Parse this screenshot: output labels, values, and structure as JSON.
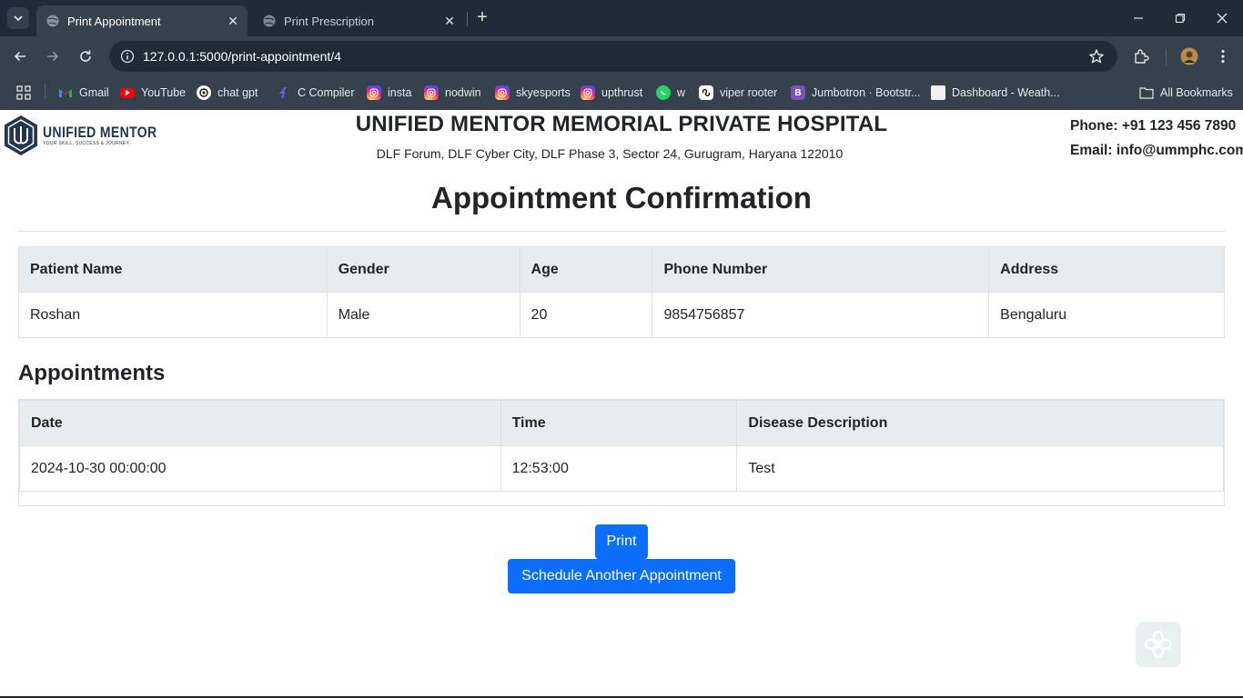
{
  "browser": {
    "tabs": [
      {
        "title": "Print Appointment",
        "active": true
      },
      {
        "title": "Print Prescription",
        "active": false
      }
    ],
    "url": "127.0.0.1:5000/print-appointment/4",
    "bookmarks": [
      {
        "label": "Gmail",
        "icon": "gmail-icon"
      },
      {
        "label": "YouTube",
        "icon": "youtube-icon"
      },
      {
        "label": "chat gpt",
        "icon": "chatgpt-icon"
      },
      {
        "label": "C Compiler",
        "icon": "compiler-icon"
      },
      {
        "label": "insta",
        "icon": "instagram-icon"
      },
      {
        "label": "nodwin",
        "icon": "instagram-icon"
      },
      {
        "label": "skyesports",
        "icon": "instagram-icon"
      },
      {
        "label": "upthrust",
        "icon": "instagram-icon"
      },
      {
        "label": "w",
        "icon": "whatsapp-icon"
      },
      {
        "label": "viper rooter",
        "icon": "viper-icon"
      },
      {
        "label": "Jumbotron · Bootstr...",
        "icon": "bootstrap-icon"
      },
      {
        "label": "Dashboard - Weath...",
        "icon": "page-icon"
      }
    ],
    "all_bookmarks_label": "All Bookmarks"
  },
  "header": {
    "logo": {
      "main": "UNIFIED MENTOR",
      "tagline": "YOUR SKILL, SUCCESS & JOURNEY"
    },
    "hospital_name": "UNIFIED MENTOR MEMORIAL PRIVATE HOSPITAL",
    "address": "DLF Forum, DLF Cyber City, DLF Phase 3, Sector 24, Gurugram, Haryana 122010",
    "phone": "Phone: +91 123 456 7890",
    "email": "Email: info@ummphc.com"
  },
  "page_title": "Appointment Confirmation",
  "patient_table": {
    "headers": [
      "Patient Name",
      "Gender",
      "Age",
      "Phone Number",
      "Address"
    ],
    "row": [
      "Roshan",
      "Male",
      "20",
      "9854756857",
      "Bengaluru"
    ]
  },
  "appointments": {
    "title": "Appointments",
    "headers": [
      "Date",
      "Time",
      "Disease Description"
    ],
    "rows": [
      [
        "2024-10-30 00:00:00",
        "12:53:00",
        "Test"
      ]
    ]
  },
  "buttons": {
    "print": "Print",
    "schedule": "Schedule Another Appointment"
  },
  "colors": {
    "primary_button": "#0d6efd",
    "table_header_bg": "#e9ecef",
    "chrome_dark": "#1f2b36",
    "chrome_toolbar": "#35414c"
  }
}
